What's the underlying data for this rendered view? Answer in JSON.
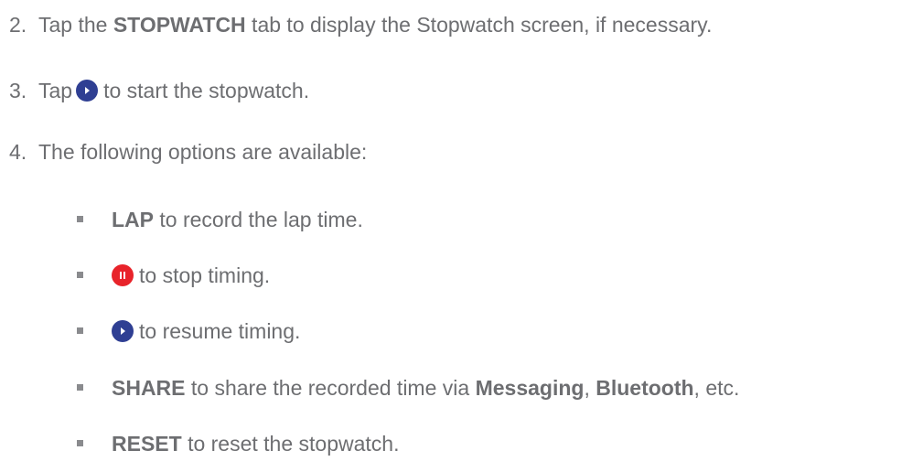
{
  "steps": [
    {
      "number": "2.",
      "prefix": "Tap the ",
      "bold": "STOPWATCH",
      "suffix": " tab to display the Stopwatch screen, if necessary."
    },
    {
      "number": "3.",
      "prefix": "Tap",
      "icon": "play-icon",
      "suffix": "to start the stopwatch."
    },
    {
      "number": "4.",
      "text": "The following options are available:"
    }
  ],
  "options": [
    {
      "bold": "LAP",
      "suffix": " to record the lap time."
    },
    {
      "icon": "pause-icon",
      "suffix": "to stop timing."
    },
    {
      "icon": "play-icon",
      "suffix": "to resume timing."
    },
    {
      "bold": "SHARE",
      "suffix_1": " to share the recorded time via ",
      "bold_2": "Messaging",
      "sep": ", ",
      "bold_3": "Bluetooth",
      "suffix_2": ", etc."
    },
    {
      "bold": "RESET",
      "suffix": " to reset the stopwatch."
    }
  ],
  "colors": {
    "text": "#6d6e71",
    "play_icon_bg": "#2f3f93",
    "pause_icon_bg": "#e8232a",
    "bullet": "#8a8b8e"
  }
}
